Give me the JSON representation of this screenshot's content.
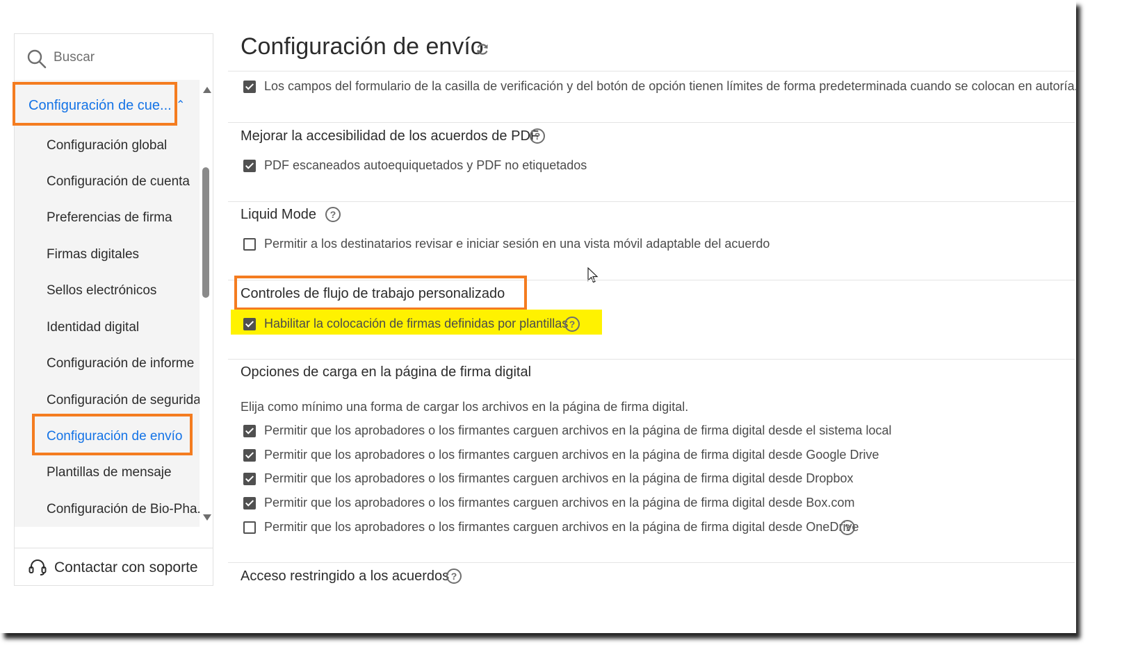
{
  "search": {
    "placeholder": "Buscar"
  },
  "sidebar": {
    "group_label": "Configuración de cue...",
    "items": [
      {
        "label": "Configuración global"
      },
      {
        "label": "Configuración de cuenta"
      },
      {
        "label": "Preferencias de firma"
      },
      {
        "label": "Firmas digitales"
      },
      {
        "label": "Sellos electrónicos"
      },
      {
        "label": "Identidad digital"
      },
      {
        "label": "Configuración de informe"
      },
      {
        "label": "Configuración de seguridad"
      },
      {
        "label": "Configuración de envío"
      },
      {
        "label": "Plantillas de mensaje"
      },
      {
        "label": "Configuración de Bio-Pha..."
      }
    ],
    "active_item": "Configuración de envío",
    "support_label": "Contactar con soporte"
  },
  "main": {
    "title": "Configuración de envío",
    "top_option": {
      "label": "Los campos del formulario de la casilla de verificación y del botón de opción tienen límites de forma predeterminada cuando se colocan en autoría.",
      "checked": true
    },
    "sections": [
      {
        "title": "Mejorar la accesibilidad de los acuerdos de PDF",
        "options": [
          {
            "label": "PDF escaneados autoequiquetados y PDF no etiquetados",
            "checked": true
          }
        ]
      },
      {
        "title": "Liquid Mode",
        "options": [
          {
            "label": "Permitir a los destinatarios revisar e iniciar sesión en una vista móvil adaptable del acuerdo",
            "checked": false
          }
        ]
      },
      {
        "title": "Controles de flujo de trabajo personalizado",
        "options": [
          {
            "label": "Habilitar la colocación de firmas definidas por plantillas",
            "checked": true
          }
        ]
      },
      {
        "title": "Opciones de carga en la página de firma digital",
        "description": "Elija como mínimo una forma de cargar los archivos en la página de firma digital.",
        "options": [
          {
            "label": "Permitir que los aprobadores o los firmantes carguen archivos en la página de firma digital desde el sistema local",
            "checked": true
          },
          {
            "label": "Permitir que los aprobadores o los firmantes carguen archivos en la página de firma digital desde Google Drive",
            "checked": true
          },
          {
            "label": "Permitir que los aprobadores o los firmantes carguen archivos en la página de firma digital desde Dropbox",
            "checked": true
          },
          {
            "label": "Permitir que los aprobadores o los firmantes carguen archivos en la página de firma digital desde Box.com",
            "checked": true
          },
          {
            "label": "Permitir que los aprobadores o los firmantes carguen archivos en la página de firma digital desde OneDrive",
            "checked": false
          }
        ]
      },
      {
        "title": "Acceso restringido a los acuerdos",
        "options": []
      }
    ]
  },
  "colors": {
    "accent": "#1473e6",
    "annotation_orange": "#f47c20",
    "highlight_yellow": "#fff200"
  },
  "icons": {
    "search": "search-icon",
    "refresh": "refresh-icon",
    "help": "help-icon",
    "support": "headset-icon",
    "chevron": "chevron-up-icon"
  }
}
